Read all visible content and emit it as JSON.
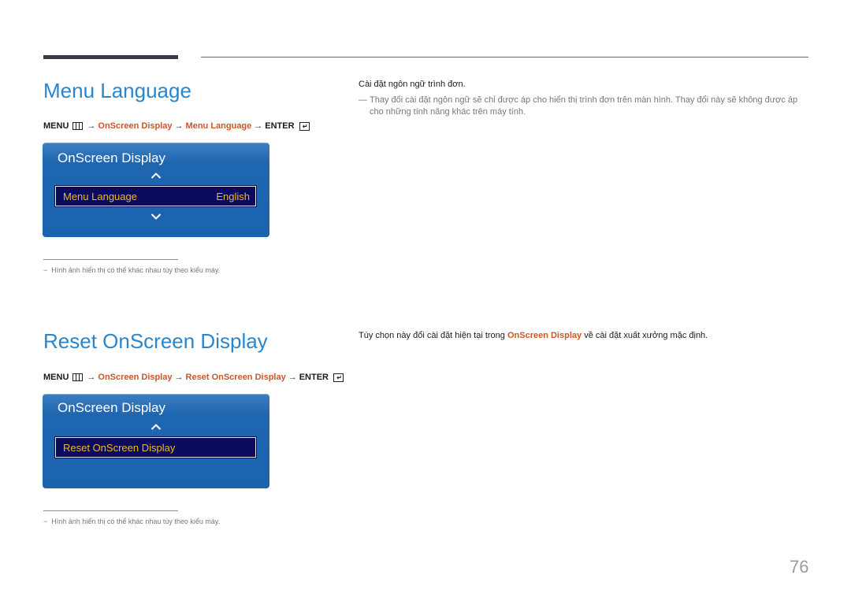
{
  "sections": [
    {
      "title": "Menu Language",
      "path": {
        "menu": "MENU",
        "arrow": "→",
        "steps": [
          "OnScreen Display",
          "Menu Language"
        ],
        "enter": "ENTER"
      },
      "osd": {
        "title": "OnScreen Display",
        "item_label": "Menu Language",
        "item_value": "English",
        "has_up": true,
        "has_down": true
      },
      "description": "Cài đặt ngôn ngữ trình đơn.",
      "note": "Thay đổi cài đặt ngôn ngữ sẽ chỉ được áp cho hiển thị trình đơn trên màn hình. Thay đổi này sẽ không được áp cho những tính năng khác trên máy tính.",
      "footnote": "Hình ảnh hiển thị có thể khác nhau tùy theo kiểu máy."
    },
    {
      "title": "Reset OnScreen Display",
      "path": {
        "menu": "MENU",
        "arrow": "→",
        "steps": [
          "OnScreen Display",
          "Reset OnScreen Display"
        ],
        "enter": "ENTER"
      },
      "osd": {
        "title": "OnScreen Display",
        "item_label": "Reset OnScreen Display",
        "has_up": true,
        "has_down": false
      },
      "description_before": "Tùy chọn này đổi cài đặt hiện tại trong",
      "description_highlight": "OnScreen Display",
      "description_after": "về cài đặt xuất xưởng mặc định.",
      "footnote": "Hình ảnh hiển thị có thể khác nhau tùy theo kiểu máy."
    }
  ],
  "icons": {
    "menu": "menu-grid-icon",
    "enter": "enter-icon",
    "up": "chevron-up-icon",
    "down": "chevron-down-icon"
  },
  "footnote_dash": "−",
  "note_dash": "—",
  "page_number": "76",
  "colors": {
    "heading": "#2a86cc",
    "highlight": "#c8572a",
    "osd_bg": "#1b63ae",
    "osd_item_bg": "#0b0b5e",
    "osd_item_text": "#f0b820"
  }
}
